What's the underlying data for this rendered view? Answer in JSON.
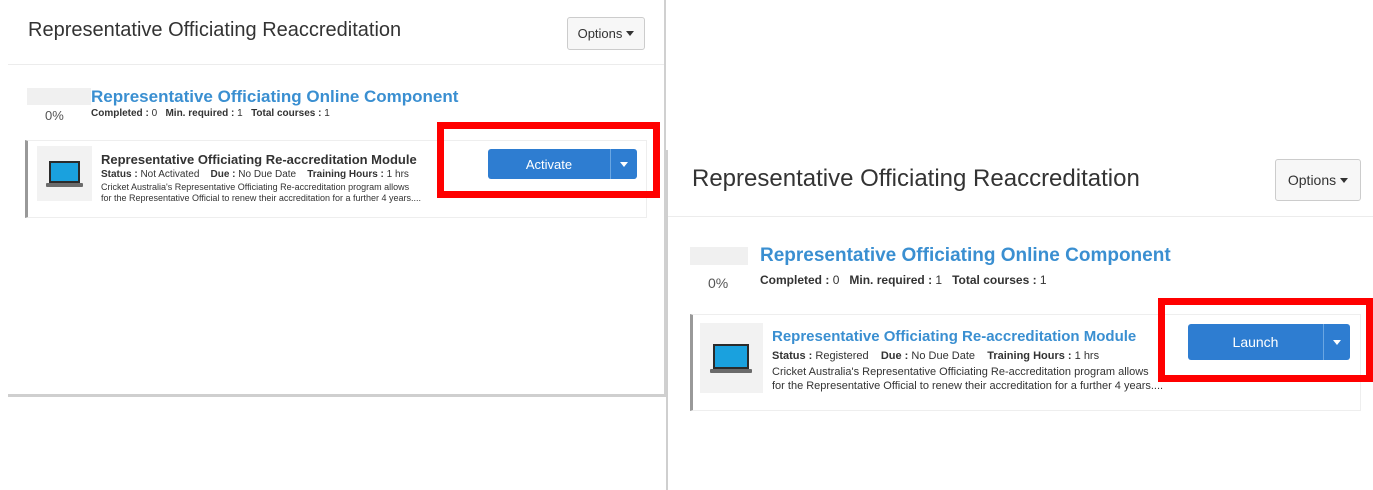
{
  "colors": {
    "accent_blue": "#3a8fd1",
    "button_blue": "#2e7dd1",
    "highlight_red": "#ff0000",
    "laptop_screen": "#1aa1de"
  },
  "panels": [
    {
      "title": "Representative Officiating Reaccreditation",
      "options_label": "Options",
      "progress_percent": "0%",
      "curriculum_title": "Representative Officiating Online Component",
      "stats": {
        "completed_label": "Completed :",
        "completed_value": "0",
        "min_label": "Min. required :",
        "min_value": "1",
        "total_label": "Total courses :",
        "total_value": "1"
      },
      "course": {
        "icon": "laptop-icon",
        "title": "Representative Officiating Re-accreditation Module",
        "status_label": "Status :",
        "status_value": "Not Activated",
        "due_label": "Due :",
        "due_value": "No Due Date",
        "hours_label": "Training Hours :",
        "hours_value": "1 hrs",
        "description_line1": "Cricket Australia's Representative Officiating Re-accreditation program allows",
        "description_line2": "for the Representative Official to renew their accreditation for a further 4 years...."
      },
      "action_label": "Activate"
    },
    {
      "title": "Representative Officiating Reaccreditation",
      "options_label": "Options",
      "progress_percent": "0%",
      "curriculum_title": "Representative Officiating Online Component",
      "stats": {
        "completed_label": "Completed :",
        "completed_value": "0",
        "min_label": "Min. required :",
        "min_value": "1",
        "total_label": "Total courses :",
        "total_value": "1"
      },
      "course": {
        "icon": "laptop-icon",
        "title": "Representative Officiating Re-accreditation Module",
        "status_label": "Status :",
        "status_value": "Registered",
        "due_label": "Due :",
        "due_value": "No Due Date",
        "hours_label": "Training Hours :",
        "hours_value": "1 hrs",
        "description_line1": "Cricket Australia's Representative Officiating Re-accreditation program allows",
        "description_line2": "for the Representative Official to renew their accreditation for a further 4 years...."
      },
      "action_label": "Launch"
    }
  ]
}
